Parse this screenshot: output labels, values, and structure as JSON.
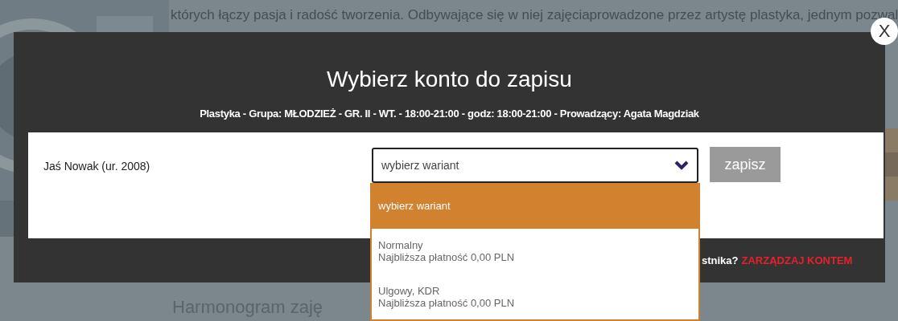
{
  "background_page": {
    "paragraph_lines": [
      "których łączy pasja i radość tworzenia. Odbywające się w niej zajęciaprowadzone przez artystę plastyka, jednym pozwal"
    ],
    "heading": "Harmonogram zaję"
  },
  "modal": {
    "close": "X",
    "title": "Wybierz konto do zapisu",
    "subtitle": "Plastyka - Grupa: MŁODZIEŻ - GR. II - WT. - 18:00-21:00 - godz: 18:00-21:00 - Prowadzący: Agata Magdziak",
    "accounts": [
      {
        "name": "Jaś Nowak (ur. 2008)",
        "select": {
          "value": "wybierz wariant",
          "expanded": true,
          "options": [
            {
              "label": "wybierz wariant",
              "selected": true
            },
            {
              "label": "Normalny",
              "detail": "Najbliższa płatność 0,00 PLN",
              "selected": false
            },
            {
              "label": "Ulgowy, KDR",
              "detail": "Najbliższa płatność 0,00 PLN",
              "selected": false
            }
          ]
        },
        "button": "zapisz"
      }
    ],
    "footer": {
      "question": "stnika?",
      "link": "ZARZĄDZAJ KONTEM"
    }
  }
}
